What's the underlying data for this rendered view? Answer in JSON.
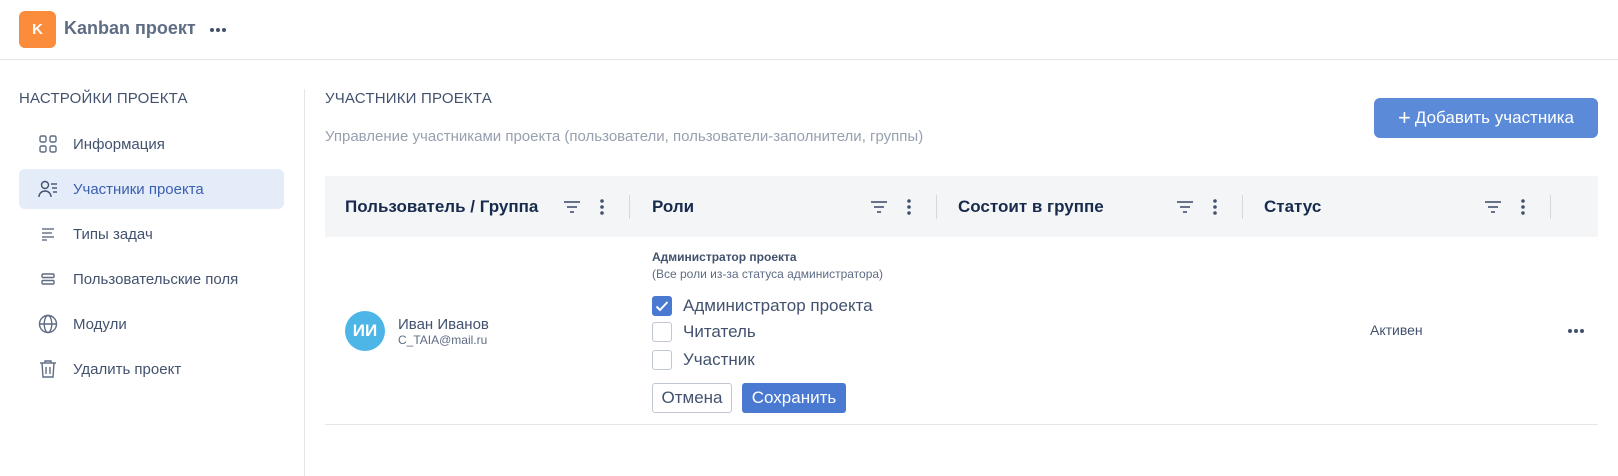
{
  "project": {
    "avatar_letter": "K",
    "title": "Kanban проект",
    "avatar_color": "#fa8c3c"
  },
  "sidebar": {
    "heading": "НАСТРОЙКИ ПРОЕКТА",
    "items": [
      {
        "label": "Информация",
        "icon": "grid-icon"
      },
      {
        "label": "Участники проекта",
        "icon": "users-icon",
        "active": true
      },
      {
        "label": "Типы задач",
        "icon": "text-lines-icon"
      },
      {
        "label": "Пользовательские поля",
        "icon": "fields-icon"
      },
      {
        "label": "Модули",
        "icon": "globe-icon"
      },
      {
        "label": "Удалить проект",
        "icon": "trash-icon"
      }
    ]
  },
  "main": {
    "title": "УЧАСТНИКИ ПРОЕКТА",
    "subtitle": "Управление участниками проекта (пользователи, пользователи-заполнители, группы)",
    "add_button": "Добавить участника",
    "accent_color": "#5b8ad8"
  },
  "table": {
    "columns": [
      "Пользователь / Группа",
      "Роли",
      "Состоит в группе",
      "Статус"
    ],
    "rows": [
      {
        "user": {
          "initials": "ИИ",
          "name": "Иван Иванов",
          "email": "C_TAIA@mail.ru"
        },
        "roles": {
          "title": "Администратор проекта",
          "note": "(Все роли из-за статуса администратора)",
          "options": [
            {
              "label": "Администратор проекта",
              "checked": true
            },
            {
              "label": "Читатель",
              "checked": false
            },
            {
              "label": "Участник",
              "checked": false
            }
          ],
          "cancel_label": "Отмена",
          "save_label": "Сохранить"
        },
        "group": "",
        "status": "Активен"
      }
    ]
  }
}
